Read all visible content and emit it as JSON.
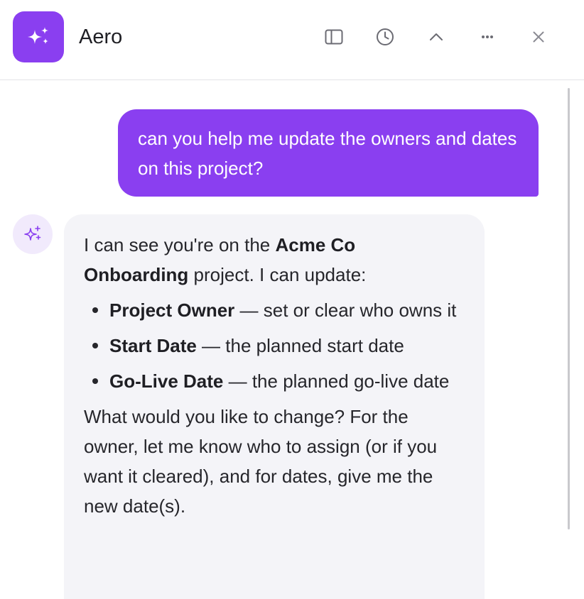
{
  "header": {
    "app_title": "Aero",
    "icons": [
      "sidebar-toggle-icon",
      "history-icon",
      "chevron-up-icon",
      "more-options-icon",
      "close-icon"
    ]
  },
  "colors": {
    "accent": "#8a3ff0",
    "user_bubble": "#8a3ff0",
    "assistant_bubble": "#f4f4f8",
    "avatar_bg": "#f1eafc"
  },
  "conversation": {
    "user_message": "can you help me update the owners and dates on this project?",
    "assistant": {
      "intro_prefix": "I can see you're on the ",
      "project_name": "Acme Co Onboarding",
      "intro_suffix": " project. I can update:",
      "items": [
        {
          "label": "Project Owner",
          "description": " — set or clear who owns it"
        },
        {
          "label": "Start Date",
          "description": " — the planned start date"
        },
        {
          "label": "Go-Live Date",
          "description": " — the planned go-live date"
        }
      ],
      "closing": "What would you like to change? For the owner, let me know who to assign (or if you want it cleared), and for dates, give me the new date(s)."
    }
  }
}
